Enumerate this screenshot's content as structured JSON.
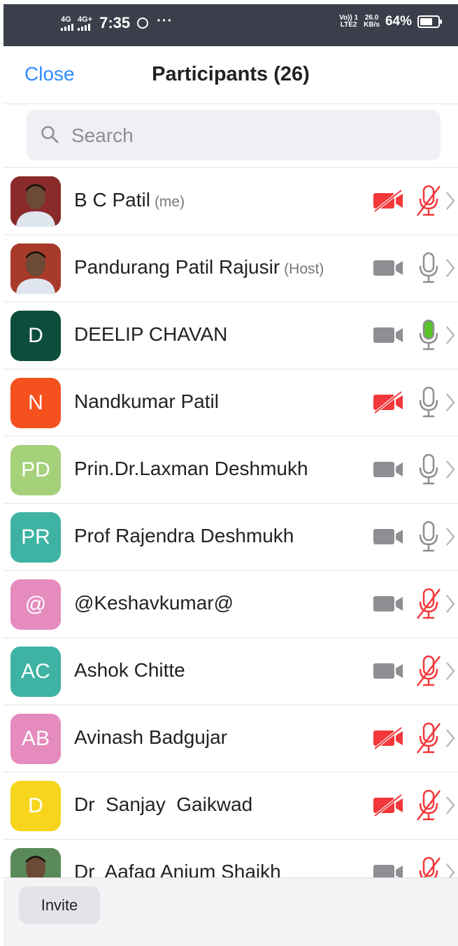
{
  "status_bar": {
    "sim1_network": "4G",
    "sim2_network": "4G+",
    "time": "7:35",
    "more": "···",
    "volte_top": "Vo)) 1",
    "volte_bottom": "LTE2",
    "speed_value": "26.0",
    "speed_unit": "KB/s",
    "battery": "64%"
  },
  "header": {
    "close_label": "Close",
    "title": "Participants (26)"
  },
  "search": {
    "placeholder": "Search"
  },
  "participants": [
    {
      "name": "B C Patil",
      "role": "(me)",
      "avatar_text": "",
      "avatar_color": "#8a2a2a",
      "photo": true,
      "video": "off",
      "audio": "muted"
    },
    {
      "name": "Pandurang Patil Rajusir",
      "role": "(Host)",
      "avatar_text": "",
      "avatar_color": "#a83a2a",
      "photo": true,
      "video": "on",
      "audio": "on"
    },
    {
      "name": "DEELIP CHAVAN",
      "role": "",
      "avatar_text": "D",
      "avatar_color": "#0d4d3c",
      "photo": false,
      "video": "on",
      "audio": "speaking"
    },
    {
      "name": "Nandkumar Patil",
      "role": "",
      "avatar_text": "N",
      "avatar_color": "#f4511e",
      "photo": false,
      "video": "off",
      "audio": "on"
    },
    {
      "name": "Prin.Dr.Laxman Deshmukh",
      "role": "",
      "avatar_text": "PD",
      "avatar_color": "#a5d17a",
      "photo": false,
      "video": "on",
      "audio": "on"
    },
    {
      "name": "Prof Rajendra Deshmukh",
      "role": "",
      "avatar_text": "PR",
      "avatar_color": "#3fb3a3",
      "photo": false,
      "video": "on",
      "audio": "on"
    },
    {
      "name": "@Keshavkumar@",
      "role": "",
      "avatar_text": "@",
      "avatar_color": "#e58bbd",
      "photo": false,
      "video": "on",
      "audio": "muted"
    },
    {
      "name": "Ashok Chitte",
      "role": "",
      "avatar_text": "AC",
      "avatar_color": "#3fb3a3",
      "photo": false,
      "video": "on",
      "audio": "muted"
    },
    {
      "name": "Avinash Badgujar",
      "role": "",
      "avatar_text": "AB",
      "avatar_color": "#e58bbd",
      "photo": false,
      "video": "off",
      "audio": "muted"
    },
    {
      "name": "Dr  Sanjay  Gaikwad",
      "role": "",
      "avatar_text": "D",
      "avatar_color": "#f7d51d",
      "photo": false,
      "video": "off",
      "audio": "muted"
    },
    {
      "name": "Dr  Aafaq Anjum Shaikh",
      "role": "",
      "avatar_text": "",
      "avatar_color": "#5a8a5a",
      "photo": true,
      "video": "on",
      "audio": "muted"
    }
  ],
  "footer": {
    "invite_label": "Invite"
  },
  "colors": {
    "accent": "#2d8cff",
    "muted_red": "#f2383a",
    "icon_gray": "#8e8e93",
    "speaking_green": "#59c328"
  }
}
